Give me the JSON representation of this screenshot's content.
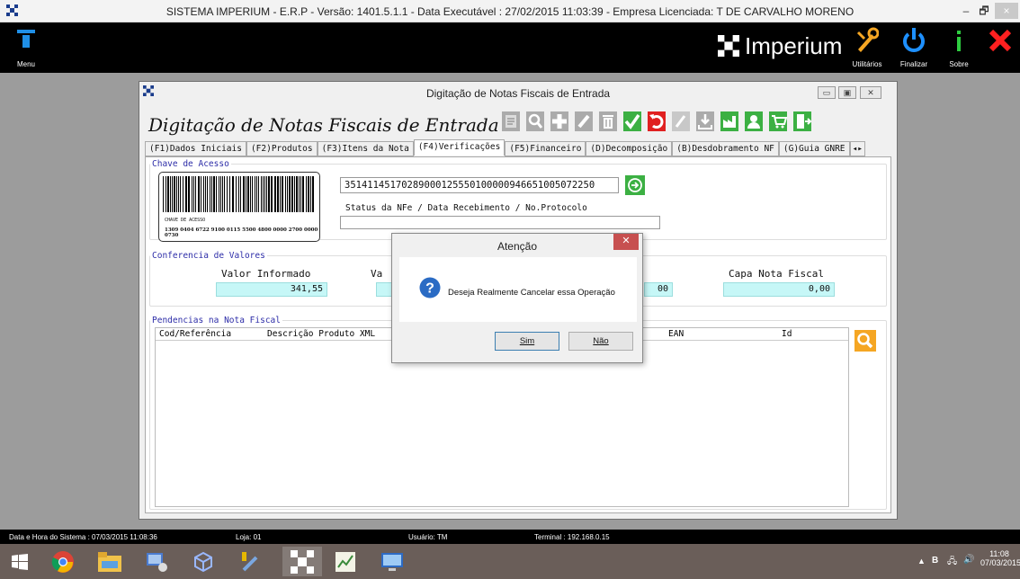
{
  "window": {
    "title": "SISTEMA IMPERIUM - E.R.P - Versão: 1401.5.1.1 - Data Executável : 27/02/2015 11:03:39 - Empresa Licenciada: T DE CARVALHO MORENO",
    "minimize": "–",
    "restore": "🗗",
    "close": "×"
  },
  "appbar": {
    "menu_label": "Menu",
    "brand": "Imperium",
    "tools": [
      {
        "label": "Utilitários",
        "icon": "tools-icon"
      },
      {
        "label": "Finalizar",
        "icon": "power-icon"
      },
      {
        "label": "Sobre",
        "icon": "info-icon"
      }
    ],
    "close_icon": "close-icon"
  },
  "dialog": {
    "title": "Digitação de Notas Fiscais de Entrada",
    "heading": "Digitação de Notas Fiscais de Entrada",
    "tabs": [
      "(F1)Dados Iniciais",
      "(F2)Produtos",
      "(F3)Itens da Nota",
      "(F4)Verificações",
      "(F5)Financeiro",
      "(D)Decomposição",
      "(B)Desdobramento NF",
      "(G)Guia GNRE"
    ],
    "active_tab": 3,
    "chave": {
      "legend": "Chave de Acesso",
      "barcode_caption": "CHAVE DE ACESSO",
      "barcode_number": "1309 0404 6722 9100 0115 5500 4800 0000 2700 0000 0730",
      "key_value": "35141145170289000125550100000946651005072250",
      "status_label": "Status da NFe / Data Recebimento / No.Protocolo",
      "status_value": ""
    },
    "conferencia": {
      "legend": "Conferencia de Valores",
      "valor_informado_label": "Valor Informado",
      "valor_informado": "341,55",
      "va_label": "Va",
      "va_value": "",
      "mid_value": "00",
      "capa_label": "Capa Nota Fiscal",
      "capa_value": "0,00"
    },
    "pendencias": {
      "legend": "Pendencias na Nota Fiscal",
      "columns": [
        "Cod/Referência",
        "Descrição Produto XML",
        "EAN",
        "Id"
      ]
    }
  },
  "modal": {
    "title": "Atenção",
    "message": "Deseja Realmente Cancelar essa Operação",
    "yes": "Sim",
    "no": "Não"
  },
  "status": {
    "datetime": "Data e Hora do Sistema : 07/03/2015 11:08:36",
    "loja": "Loja: 01",
    "usuario": "Usuário: TM",
    "terminal": "Terminal : 192.168.0.15"
  },
  "taskbar": {
    "clock_time": "11:08",
    "clock_date": "07/03/2015",
    "tray_b": "B"
  }
}
